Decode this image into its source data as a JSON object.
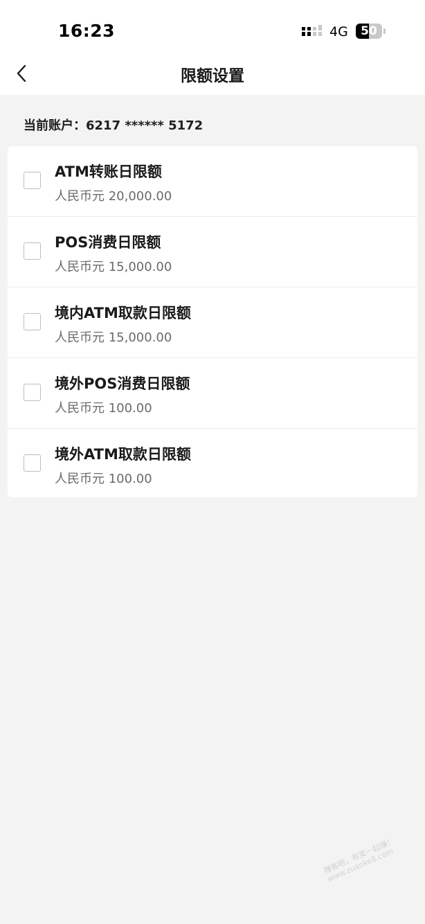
{
  "status_bar": {
    "time": "16:23",
    "network": "4G",
    "battery_level": "50",
    "battery_fraction": 0.5
  },
  "nav": {
    "title": "限额设置",
    "back_icon": "chevron-left-icon"
  },
  "account": {
    "label": "当前账户：6217 ****** 5172"
  },
  "limits": [
    {
      "name": "ATM转账日限额",
      "amount": "人民币元 20,000.00",
      "checked": false
    },
    {
      "name": "POS消费日限额",
      "amount": "人民币元 15,000.00",
      "checked": false
    },
    {
      "name": "境内ATM取款日限额",
      "amount": "人民币元 15,000.00",
      "checked": false
    },
    {
      "name": "境外POS消费日限额",
      "amount": "人民币元 100.00",
      "checked": false
    },
    {
      "name": "境外ATM取款日限额",
      "amount": "人民币元 100.00",
      "checked": false
    }
  ],
  "watermark": {
    "line1": "赚客吧，有奖一起赚！",
    "line2": "www.zuanke8.com"
  },
  "colors": {
    "page_background": "#f3f3f3",
    "card_background": "#ffffff",
    "primary_text": "#1a1a1a",
    "secondary_text": "#6a6a6a",
    "checkbox_border": "#bdbdbd"
  }
}
